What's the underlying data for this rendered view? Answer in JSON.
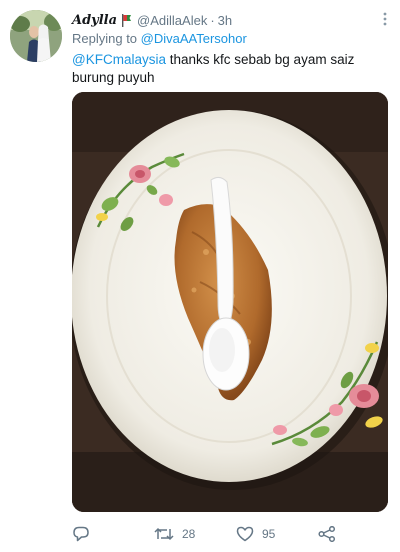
{
  "tweet": {
    "author": {
      "display_name": "Adylla",
      "flag_icon": "flag-icon",
      "handle": "@AdillaAlek",
      "separator": "·",
      "time": "3h"
    },
    "reply": {
      "prefix": "Replying to",
      "mention": "@DivaAATersohor"
    },
    "text": {
      "mention": "@KFCmalaysia",
      "body": " thanks kfc sebab bg ayam saiz burung puyuh"
    },
    "media": {
      "description_icon": "photo-fried-chicken-plate"
    },
    "actions": {
      "reply_icon": "reply-icon",
      "retweet_icon": "retweet-icon",
      "retweet_count": "28",
      "like_icon": "heart-icon",
      "like_count": "95",
      "share_icon": "share-icon"
    }
  },
  "colors": {
    "link": "#1b95e0",
    "secondary_text": "#657786",
    "primary_text": "#14171a"
  }
}
